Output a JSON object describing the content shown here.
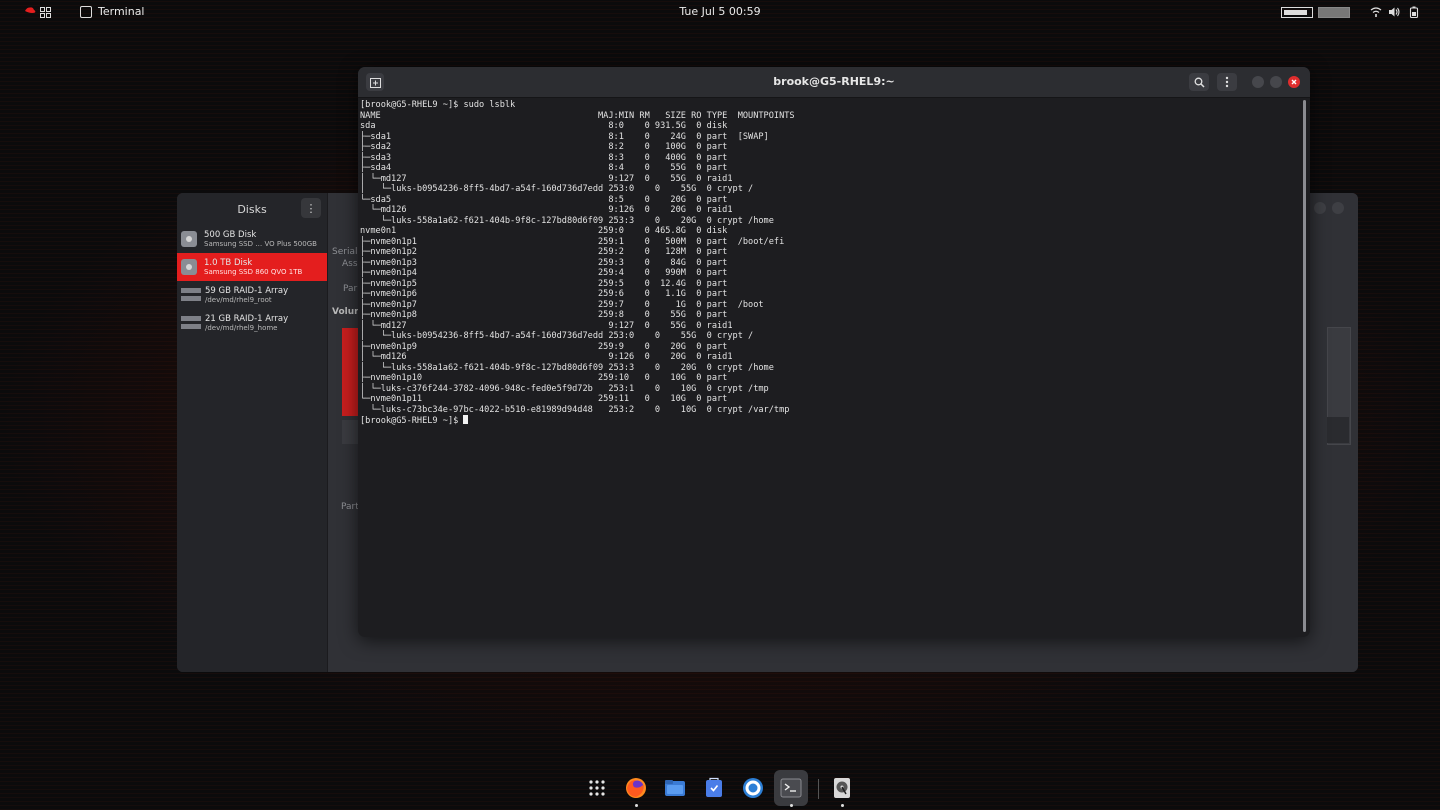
{
  "topbar": {
    "app_name": "Terminal",
    "clock": "Tue Jul 5  00:59",
    "battery1_level": 0.9
  },
  "disks": {
    "title": "Disks",
    "menu_glyph": "⋮",
    "drives": [
      {
        "title": "500 GB Disk",
        "subtitle": "Samsung SSD … VO Plus 500GB",
        "kind": "disk"
      },
      {
        "title": "1.0 TB Disk",
        "subtitle": "Samsung SSD 860 QVO 1TB",
        "kind": "disk",
        "selected": true
      },
      {
        "title": "59 GB RAID-1 Array",
        "subtitle": "/dev/md/rhel9_root",
        "kind": "raid"
      },
      {
        "title": "21 GB RAID-1 Array",
        "subtitle": "/dev/md/rhel9_home",
        "kind": "raid"
      }
    ],
    "ghost_labels": [
      "Serial",
      "Ass",
      "Par",
      "Volur",
      "Part"
    ]
  },
  "terminal": {
    "title": "brook@G5-RHEL9:~",
    "lines": [
      "[brook@G5-RHEL9 ~]$ sudo lsblk",
      "NAME                                          MAJ:MIN RM   SIZE RO TYPE  MOUNTPOINTS",
      "sda                                             8:0    0 931.5G  0 disk",
      "├─sda1                                          8:1    0    24G  0 part  [SWAP]",
      "├─sda2                                          8:2    0   100G  0 part",
      "├─sda3                                          8:3    0   400G  0 part",
      "├─sda4                                          8:4    0    55G  0 part",
      "│ └─md127                                       9:127  0    55G  0 raid1",
      "│   └─luks-b0954236-8ff5-4bd7-a54f-160d736d7edd 253:0    0    55G  0 crypt /",
      "└─sda5                                          8:5    0    20G  0 part",
      "  └─md126                                       9:126  0    20G  0 raid1",
      "    └─luks-558a1a62-f621-404b-9f8c-127bd80d6f09 253:3    0    20G  0 crypt /home",
      "nvme0n1                                       259:0    0 465.8G  0 disk",
      "├─nvme0n1p1                                   259:1    0   500M  0 part  /boot/efi",
      "├─nvme0n1p2                                   259:2    0   128M  0 part",
      "├─nvme0n1p3                                   259:3    0    84G  0 part",
      "├─nvme0n1p4                                   259:4    0   990M  0 part",
      "├─nvme0n1p5                                   259:5    0  12.4G  0 part",
      "├─nvme0n1p6                                   259:6    0   1.1G  0 part",
      "├─nvme0n1p7                                   259:7    0     1G  0 part  /boot",
      "├─nvme0n1p8                                   259:8    0    55G  0 part",
      "│ └─md127                                       9:127  0    55G  0 raid1",
      "│   └─luks-b0954236-8ff5-4bd7-a54f-160d736d7edd 253:0    0    55G  0 crypt /",
      "├─nvme0n1p9                                   259:9    0    20G  0 part",
      "│ └─md126                                       9:126  0    20G  0 raid1",
      "│   └─luks-558a1a62-f621-404b-9f8c-127bd80d6f09 253:3    0    20G  0 crypt /home",
      "├─nvme0n1p10                                  259:10   0    10G  0 part",
      "│ └─luks-c376f244-3782-4096-948c-fed0e5f9d72b   253:1    0    10G  0 crypt /tmp",
      "└─nvme0n1p11                                  259:11   0    10G  0 part",
      "  └─luks-c73bc34e-97bc-4022-b510-e81989d94d48   253:2    0    10G  0 crypt /var/tmp"
    ],
    "prompt": "[brook@G5-RHEL9 ~]$ "
  },
  "dock": {
    "items": [
      {
        "name": "app-grid",
        "running": false
      },
      {
        "name": "firefox",
        "running": true
      },
      {
        "name": "files",
        "running": false
      },
      {
        "name": "software",
        "running": false
      },
      {
        "name": "help",
        "running": false
      },
      {
        "name": "terminal",
        "running": true,
        "active": true
      },
      {
        "name": "disks",
        "running": true
      }
    ]
  },
  "colors": {
    "accent_red": "#e41e1e",
    "window_bg": "#2b2c30",
    "terminal_bg": "#1d1d20"
  }
}
